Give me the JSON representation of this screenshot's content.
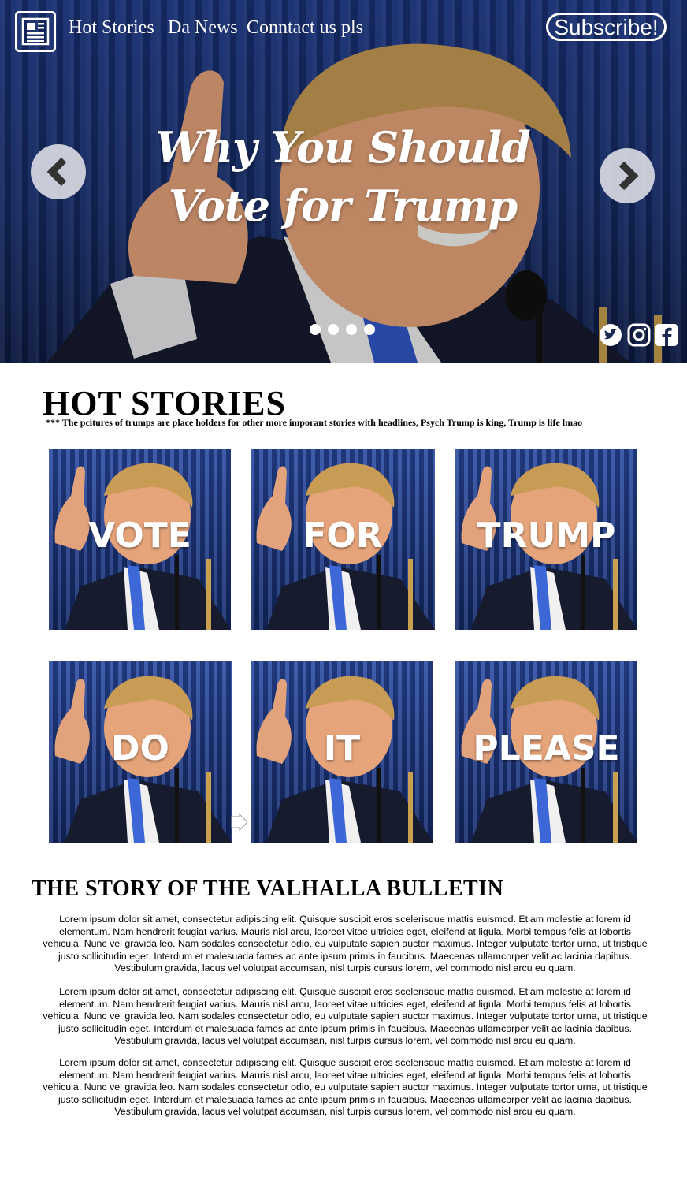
{
  "nav": {
    "links": [
      "Hot Stories",
      "Da News",
      "Conntact us pls"
    ],
    "subscribe_label": "Subscribe!",
    "logo_icon": "newspaper-icon"
  },
  "hero": {
    "title": "Why You Should Vote for Trump",
    "prev_icon": "chevron-left-icon",
    "next_icon": "chevron-right-icon",
    "slide_count": 4,
    "social_icons": [
      "twitter-icon",
      "instagram-icon",
      "facebook-icon"
    ]
  },
  "hot_stories": {
    "title": "HOT STORIES",
    "note": "*** The pcitures of trumps are place holders for other more imporant stories with headlines, Psych Trump is king, Trump is life lmao",
    "tiles": [
      "VOTE",
      "FOR",
      "TRUMP",
      "DO",
      "IT",
      "PLEASE"
    ]
  },
  "story": {
    "title": "THE STORY OF THE VALHALLA BULLETIN",
    "paragraphs": [
      "Lorem ipsum dolor sit amet, consectetur adipiscing elit. Quisque suscipit eros scelerisque mattis euismod. Etiam molestie at lorem id elementum. Nam hendrerit feugiat varius. Mauris nisl arcu, laoreet vitae ultricies eget, eleifend at ligula. Morbi tempus felis at lobortis vehicula. Nunc vel gravida leo. Nam sodales consectetur odio, eu vulputate sapien auctor maximus. Integer vulputate tortor urna, ut tristique justo sollicitudin eget. Interdum et malesuada fames ac ante ipsum primis in faucibus. Maecenas ullamcorper velit ac lacinia dapibus. Vestibulum gravida, lacus vel volutpat accumsan, nisl turpis cursus lorem, vel commodo nisl arcu eu quam.",
      "Lorem ipsum dolor sit amet, consectetur adipiscing elit. Quisque suscipit eros scelerisque mattis euismod. Etiam molestie at lorem id elementum. Nam hendrerit feugiat varius. Mauris nisl arcu, laoreet vitae ultricies eget, eleifend at ligula. Morbi tempus felis at lobortis vehicula. Nunc vel gravida leo. Nam sodales consectetur odio, eu vulputate sapien auctor maximus. Integer vulputate tortor urna, ut tristique justo sollicitudin eget. Interdum et malesuada fames ac ante ipsum primis in faucibus. Maecenas ullamcorper velit ac lacinia dapibus. Vestibulum gravida, lacus vel volutpat accumsan, nisl turpis cursus lorem, vel commodo nisl arcu eu quam.",
      "Lorem ipsum dolor sit amet, consectetur adipiscing elit. Quisque suscipit eros scelerisque mattis euismod. Etiam molestie at lorem id elementum. Nam hendrerit feugiat varius. Mauris nisl arcu, laoreet vitae ultricies eget, eleifend at ligula. Morbi tempus felis at lobortis vehicula. Nunc vel gravida leo. Nam sodales consectetur odio, eu vulputate sapien auctor maximus. Integer vulputate tortor urna, ut tristique justo sollicitudin eget. Interdum et malesuada fames ac ante ipsum primis in faucibus. Maecenas ullamcorper velit ac lacinia dapibus. Vestibulum gravida, lacus vel volutpat accumsan, nisl turpis cursus lorem, vel commodo nisl arcu eu quam."
    ]
  }
}
